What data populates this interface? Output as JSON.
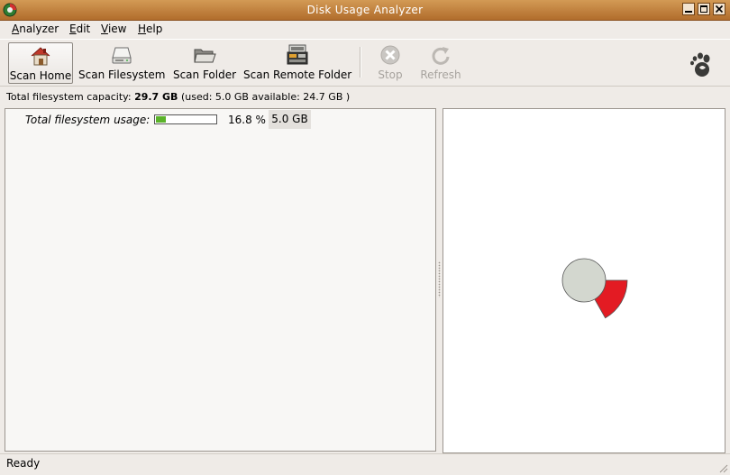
{
  "window": {
    "title": "Disk Usage Analyzer"
  },
  "menubar": {
    "items": [
      {
        "mnemonic": "A",
        "rest": "nalyzer"
      },
      {
        "mnemonic": "E",
        "rest": "dit"
      },
      {
        "mnemonic": "V",
        "rest": "iew"
      },
      {
        "mnemonic": "H",
        "rest": "elp"
      }
    ]
  },
  "toolbar": {
    "scan_home": "Scan Home",
    "scan_filesystem": "Scan Filesystem",
    "scan_folder": "Scan Folder",
    "scan_remote_folder": "Scan Remote Folder",
    "stop": "Stop",
    "refresh": "Refresh"
  },
  "capacity": {
    "label": "Total filesystem capacity:",
    "total": "29.7 GB",
    "detail": "(used: 5.0 GB available: 24.7 GB )"
  },
  "usage": {
    "label": "Total filesystem usage:",
    "fraction": 0.168,
    "percent_text": "16.8 %",
    "size_text": "5.0 GB"
  },
  "ring": {
    "used_fraction": 0.168,
    "center_color": "#d3d7cf",
    "used_color": "#e31b23"
  },
  "status": {
    "text": "Ready"
  },
  "colors": {
    "titlebar": "#c4823f",
    "usage_bar_fill": "#5bb32a"
  }
}
